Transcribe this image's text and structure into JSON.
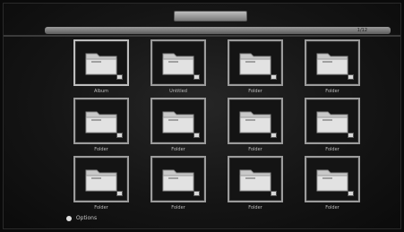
{
  "window": {
    "title": ""
  },
  "path_bar": {
    "path": "",
    "count": "1/12"
  },
  "items": [
    {
      "label": "Album"
    },
    {
      "label": "Untitled"
    },
    {
      "label": "Folder"
    },
    {
      "label": "Folder"
    },
    {
      "label": "Folder"
    },
    {
      "label": "Folder"
    },
    {
      "label": "Folder"
    },
    {
      "label": "Folder"
    },
    {
      "label": "Folder"
    },
    {
      "label": "Folder"
    },
    {
      "label": "Folder"
    },
    {
      "label": "Folder"
    }
  ],
  "footer": {
    "button_label": "Options"
  },
  "icons": {
    "item": "folder-icon",
    "badge": "badge-icon",
    "hint": "red-dot-icon"
  }
}
